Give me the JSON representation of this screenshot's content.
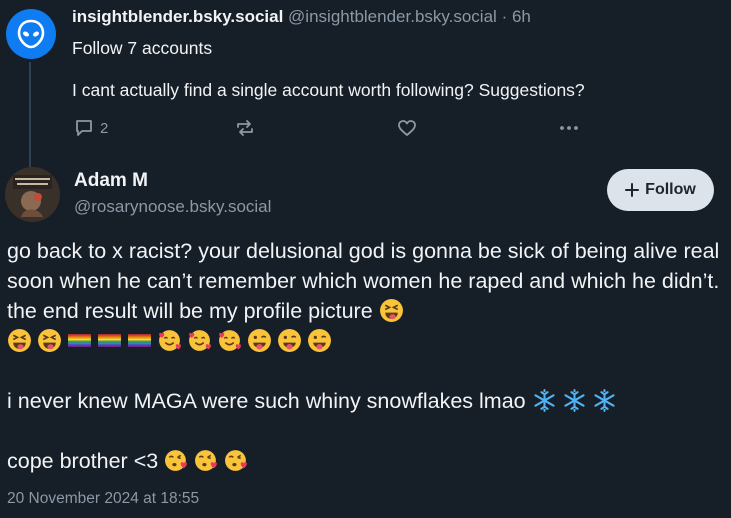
{
  "post1": {
    "author": "insightblender.bsky.social",
    "handle": "@insightblender.bsky.social",
    "separator": "·",
    "time": "6h",
    "line1": "Follow 7 accounts",
    "line2": "I cant actually find a single account worth following? Suggestions?",
    "reply_count": "2",
    "avatar_icon": "alien-icon"
  },
  "post2": {
    "name": "Adam M",
    "handle": "@rosarynoose.bsky.social",
    "follow_label": "Follow",
    "para1": "go back to x racist? your delusional god is gonna be sick of being alive real soon when he can’t remember which women he raped and which he didn’t. the end result will be my profile picture",
    "para2": "i never knew MAGA were such whiny snowflakes lmao",
    "para3": "cope brother <3",
    "timestamp": "20 November 2024 at 18:55"
  },
  "colors": {
    "background": "#161e27",
    "muted_text": "#8b98a5",
    "avatar_blue": "#0f7cf2",
    "follow_bg": "#dde3ea"
  }
}
